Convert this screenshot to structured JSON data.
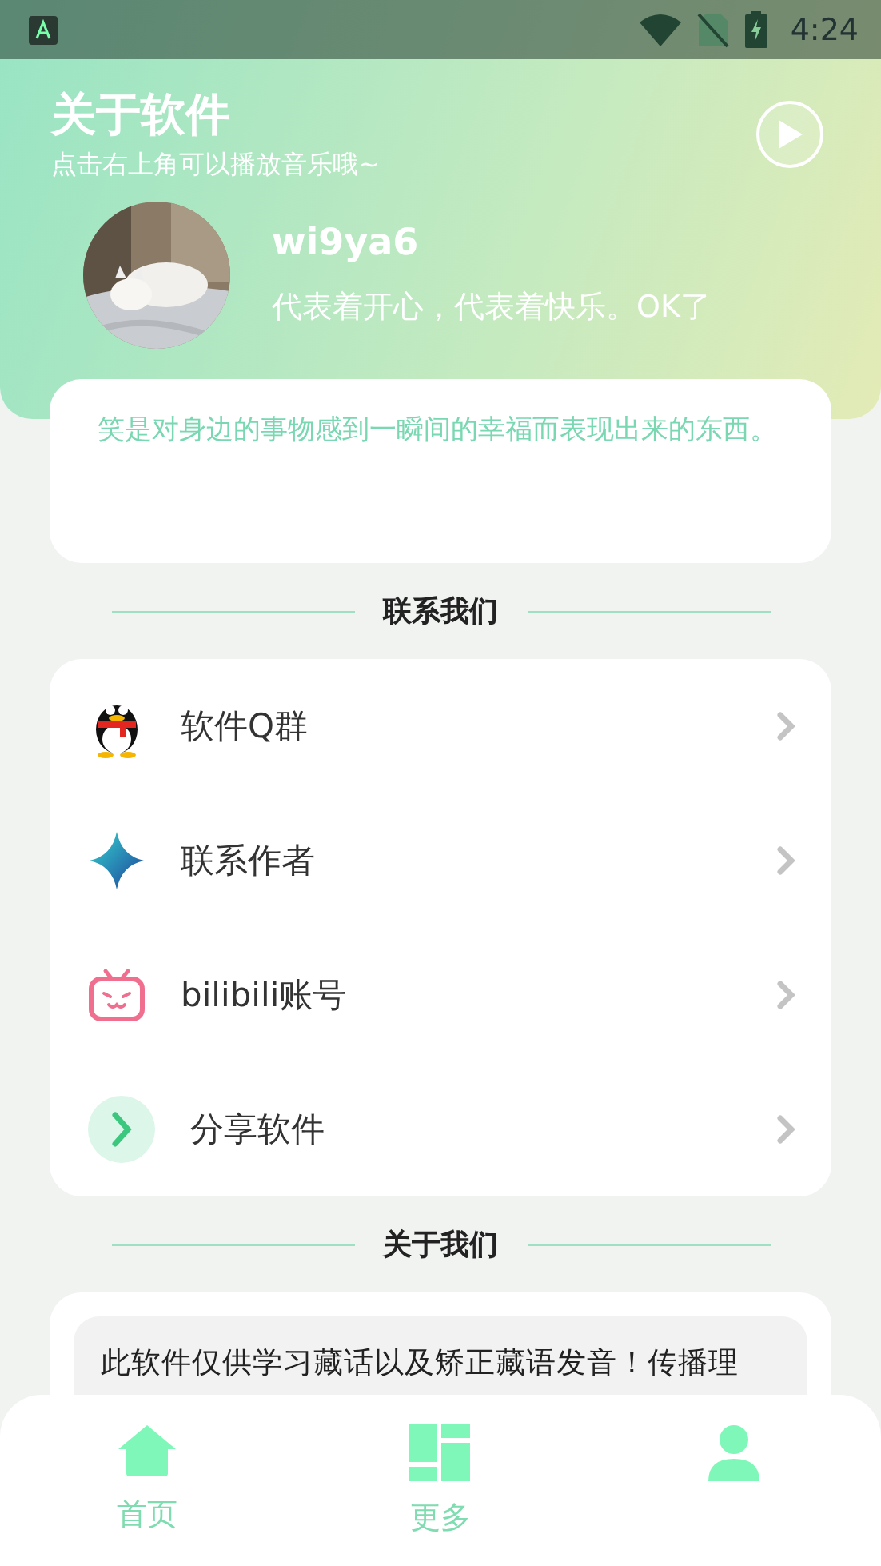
{
  "status_bar": {
    "time": "4:24"
  },
  "header": {
    "title": "关于软件",
    "subtitle": "点击右上角可以播放音乐哦~",
    "user": {
      "name": "wi9ya6",
      "motto": "代表着开心，代表着快乐。OK了"
    }
  },
  "quote": "笑是对身边的事物感到一瞬间的幸福而表现出来的东西。",
  "contact": {
    "heading": "联系我们",
    "items": [
      {
        "kind": "qq",
        "label": "软件Q群"
      },
      {
        "kind": "star",
        "label": "联系作者"
      },
      {
        "kind": "tv",
        "label": "bilibili账号"
      },
      {
        "kind": "share",
        "label": "分享软件"
      }
    ]
  },
  "about": {
    "heading": "关于我们",
    "text": "此软件仅供学习藏话以及矫正藏语发音！传播理"
  },
  "nav": [
    {
      "kind": "home",
      "label": "首页"
    },
    {
      "kind": "grid",
      "label": "更多"
    },
    {
      "kind": "person"
    }
  ]
}
